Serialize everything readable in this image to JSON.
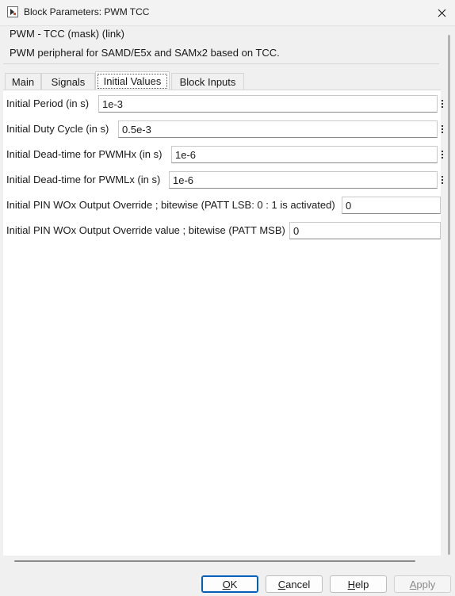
{
  "window": {
    "title": "Block Parameters: PWM TCC",
    "icon": "simulink-block-icon",
    "close_icon": "close-icon"
  },
  "mask": {
    "title": "PWM - TCC (mask) (link)",
    "description": "PWM peripheral for SAMD/E5x and SAMx2 based on TCC."
  },
  "tabs": [
    {
      "label": "Main",
      "active": false
    },
    {
      "label": "Signals",
      "active": false
    },
    {
      "label": "Initial Values",
      "active": true
    },
    {
      "label": "Block Inputs",
      "active": false
    }
  ],
  "params": [
    {
      "label": "Initial Period (in s)",
      "value": "1e-3"
    },
    {
      "label": "Initial Duty Cycle (in s)",
      "value": "0.5e-3"
    },
    {
      "label": "Initial Dead-time for PWMHx (in s)",
      "value": "1e-6"
    },
    {
      "label": "Initial Dead-time for PWMLx (in s)",
      "value": "1e-6"
    },
    {
      "label": "Initial PIN WOx Output Override ; bitewise (PATT LSB: 0 : 1 is activated)",
      "value": "0"
    },
    {
      "label": "Initial PIN WOx Output Override value ; bitewise (PATT MSB)",
      "value": "0"
    }
  ],
  "buttons": {
    "ok_first": "O",
    "ok_rest": "K",
    "cancel_first": "C",
    "cancel_rest": "ancel",
    "help_first": "H",
    "help_rest": "elp",
    "apply_first": "A",
    "apply_rest": "pply"
  },
  "colors": {
    "accent": "#005fb8",
    "window_bg": "#f0f0f0",
    "panel_bg": "#ffffff"
  }
}
